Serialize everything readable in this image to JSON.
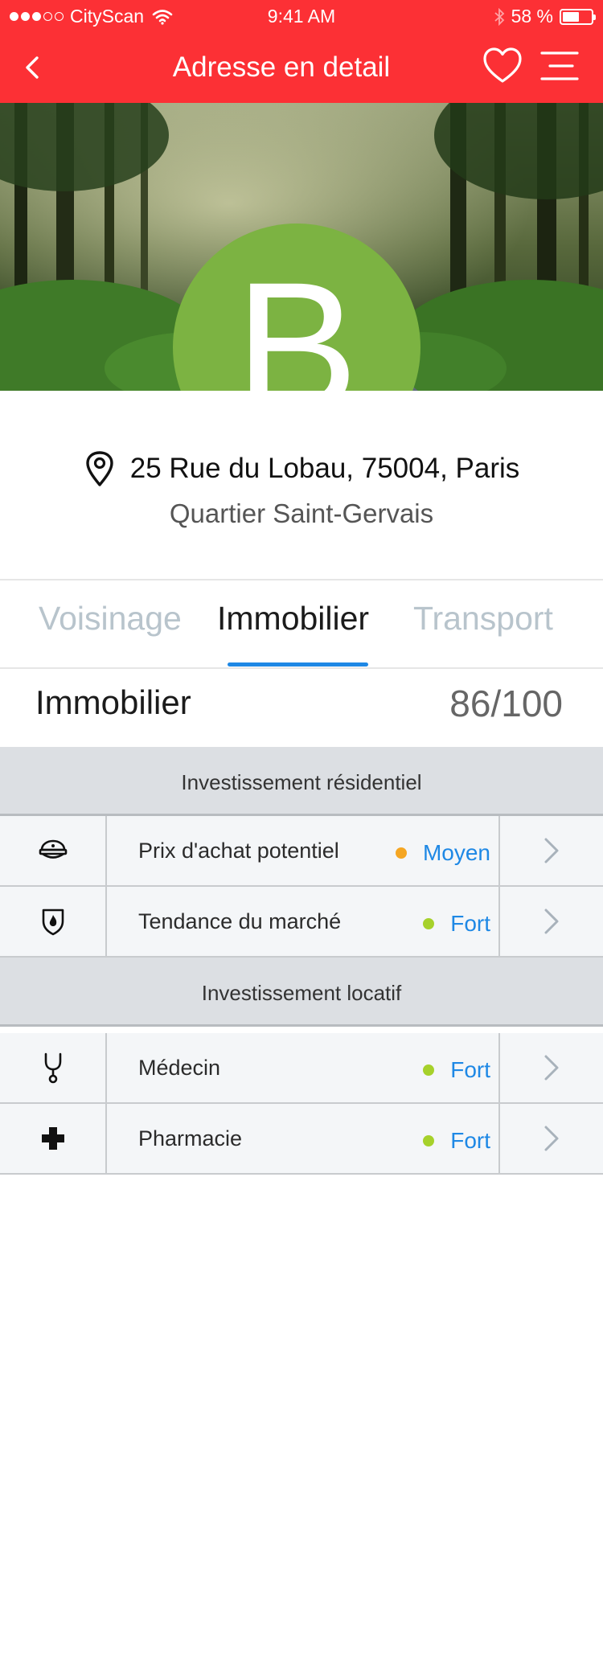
{
  "status_bar": {
    "carrier": "CityScan",
    "time": "9:41 AM",
    "battery_text": "58 %",
    "battery_level": 0.58
  },
  "nav": {
    "title": "Adresse en detail",
    "back_icon": "chevron-left-icon",
    "favorite_icon": "heart-icon",
    "menu_icon": "hamburger-menu-icon"
  },
  "hero": {
    "grade": "B",
    "grade_color": "#7cb342"
  },
  "address": {
    "street": "25 Rue du Lobau, 75004, Paris",
    "district": "Quartier Saint-Gervais",
    "icon": "location-pin-icon"
  },
  "tabs": [
    {
      "label": "Voisinage",
      "active": false
    },
    {
      "label": "Immobilier",
      "active": true
    },
    {
      "label": "Transport",
      "active": false
    }
  ],
  "section": {
    "title": "Immobilier",
    "score": "86/100"
  },
  "groups": [
    {
      "title": "Investissement résidentiel",
      "rows": [
        {
          "icon": "police-cap-icon",
          "label": "Prix d'achat potentiel",
          "status": "Moyen",
          "dot_color": "#f5a623"
        },
        {
          "icon": "fire-shield-icon",
          "label": "Tendance du marché",
          "status": "Fort",
          "dot_color": "#a6d12b"
        }
      ]
    },
    {
      "title": "Investissement locatif",
      "rows": [
        {
          "icon": "stethoscope-icon",
          "label": "Médecin",
          "status": "Fort",
          "dot_color": "#a6d12b"
        },
        {
          "icon": "medical-cross-icon",
          "label": "Pharmacie",
          "status": "Fort",
          "dot_color": "#a6d12b"
        }
      ]
    }
  ],
  "colors": {
    "header_red": "#fc3035",
    "accent_blue": "#1e88e5"
  }
}
